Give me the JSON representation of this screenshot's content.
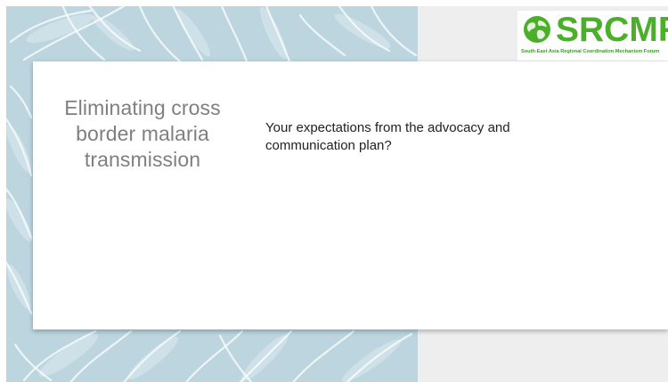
{
  "slide": {
    "title": "Eliminating cross border malaria transmission",
    "body": "Your expectations from the advocacy and communication plan?"
  },
  "logo": {
    "name": "SRCMF",
    "tagline": "South-East Asia Regional Coordination Mechanism Forum",
    "icon": "globe-icon",
    "color": "#4caf2a"
  },
  "colors": {
    "leaf_background": "#bcd5df",
    "side_panel": "#eeeeee",
    "title_text": "#7f7f7f"
  }
}
